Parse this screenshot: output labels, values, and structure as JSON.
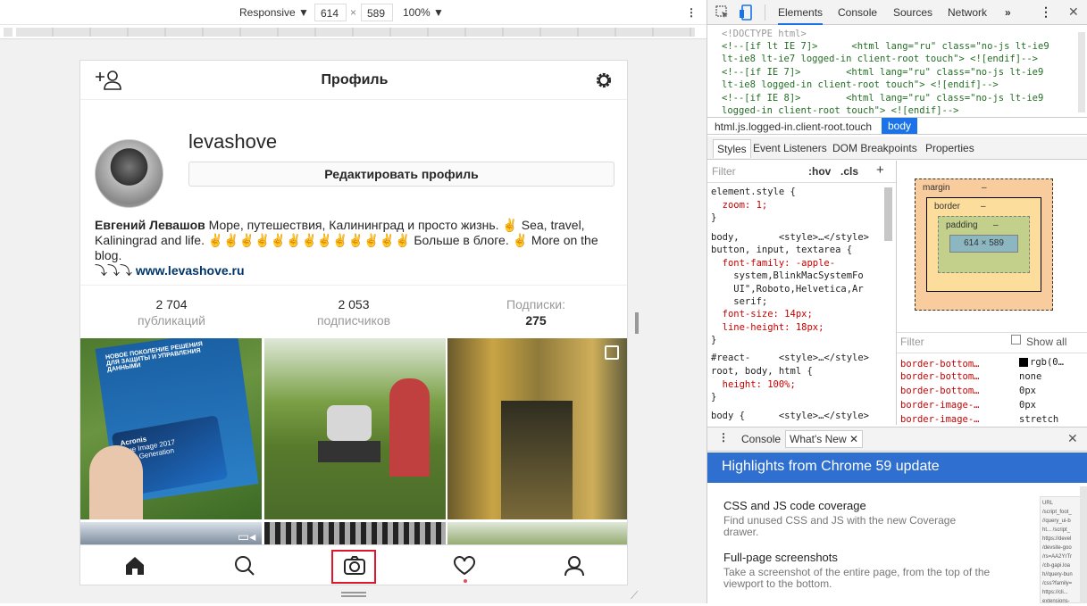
{
  "device_toolbar": {
    "mode": "Responsive",
    "width": "614",
    "sep": "×",
    "height": "589",
    "zoom": "100%"
  },
  "profile": {
    "title": "Профиль",
    "username": "levashove",
    "edit_button": "Редактировать профиль",
    "bio_name": "Евгений Левашов",
    "bio_text1": " Море, путешествия, Калининград и просто жизнь. ✌ Sea, travel,",
    "bio_text2": "Kaliningrad and life. ✌✌✌✌✌✌✌✌✌✌✌✌✌ Больше в блоге. ✌ More on the blog.",
    "bio_arrows": "⤵⤵⤵ ",
    "bio_link": "www.levashove.ru",
    "stats": [
      {
        "value": "2 704",
        "label": "публикаций"
      },
      {
        "value": "2 053",
        "label": "подписчиков"
      },
      {
        "label": "Подписки:",
        "value": "275"
      }
    ],
    "tile1": {
      "line1": "НОВОЕ ПОКОЛЕНИЕ РЕШЕНИЯ",
      "line2": "ДЛЯ ЗАЩИТЫ И УПРАВЛЕНИЯ ДАННЫМИ",
      "card1": "Acronis",
      "card2": "True Image 2017",
      "card3": "New Generation"
    }
  },
  "devtools": {
    "tabs": [
      "Elements",
      "Console",
      "Sources",
      "Network",
      "»"
    ],
    "html_lines": [
      "<!DOCTYPE html>",
      "<!--[if lt IE 7]>      <html lang=\"ru\" class=\"no-js lt-ie9",
      "lt-ie8 lt-ie7 logged-in client-root touch\"> <![endif]-->",
      "<!--[if IE 7]>        <html lang=\"ru\" class=\"no-js lt-ie9",
      "lt-ie8 logged-in client-root touch\"> <![endif]-->",
      "<!--[if IE 8]>        <html lang=\"ru\" class=\"no-js lt-ie9",
      "logged-in client-root touch\"> <![endif]-->"
    ],
    "crumb1": "html.js.logged-in.client-root.touch",
    "crumb2": "body",
    "subtabs": [
      "Styles",
      "Event Listeners",
      "DOM Breakpoints",
      "Properties"
    ],
    "filter_placeholder": "Filter",
    "hov": ":hov",
    "cls": ".cls",
    "plus": "+",
    "style_lines": [
      "element.style {",
      "  zoom: 1;",
      "}",
      "body,       <style>…</style>",
      "button, input, textarea {",
      "  font-family: -apple-",
      "    system,BlinkMacSystemFo",
      "    UI\",Roboto,Helvetica,Ar",
      "    serif;",
      "  font-size: 14px;",
      "  line-height: 18px;",
      "}",
      "#react-     <style>…</style>",
      "root, body, html {",
      "  height: 100%;",
      "}",
      "body {      <style>…</style>"
    ],
    "box": {
      "margin": "margin",
      "border": "border",
      "padding": "padding",
      "content": "614 × 589",
      "dash": "–"
    },
    "computed_filter": "Filter",
    "show_all": "Show all",
    "computed": [
      {
        "prop": "border-bottom…",
        "val": "rgb(0…"
      },
      {
        "prop": "border-bottom…",
        "val": "none"
      },
      {
        "prop": "border-bottom…",
        "val": "0px"
      },
      {
        "prop": "border-image-…",
        "val": "0px"
      },
      {
        "prop": "border-image-…",
        "val": "stretch"
      }
    ],
    "drawer_tabs": [
      "Console",
      "What's New"
    ],
    "highlights": "Highlights from Chrome 59 update",
    "news": [
      {
        "title": "CSS and JS code coverage",
        "desc": "Find unused CSS and JS with the new Coverage drawer."
      },
      {
        "title": "Full-page screenshots",
        "desc": "Take a screenshot of the entire page, from the top of the viewport to the bottom."
      }
    ],
    "thumb_lines": [
      "URL",
      "/script_foot_",
      "//query_ui-b",
      "ht... /script_",
      "https://devel",
      "/devsite-goo",
      "/rs=AA2YrTr",
      "/cb-gapi.loa",
      "h//query-bun",
      "/css?family=",
      "https://cli...",
      "extensions-"
    ]
  }
}
